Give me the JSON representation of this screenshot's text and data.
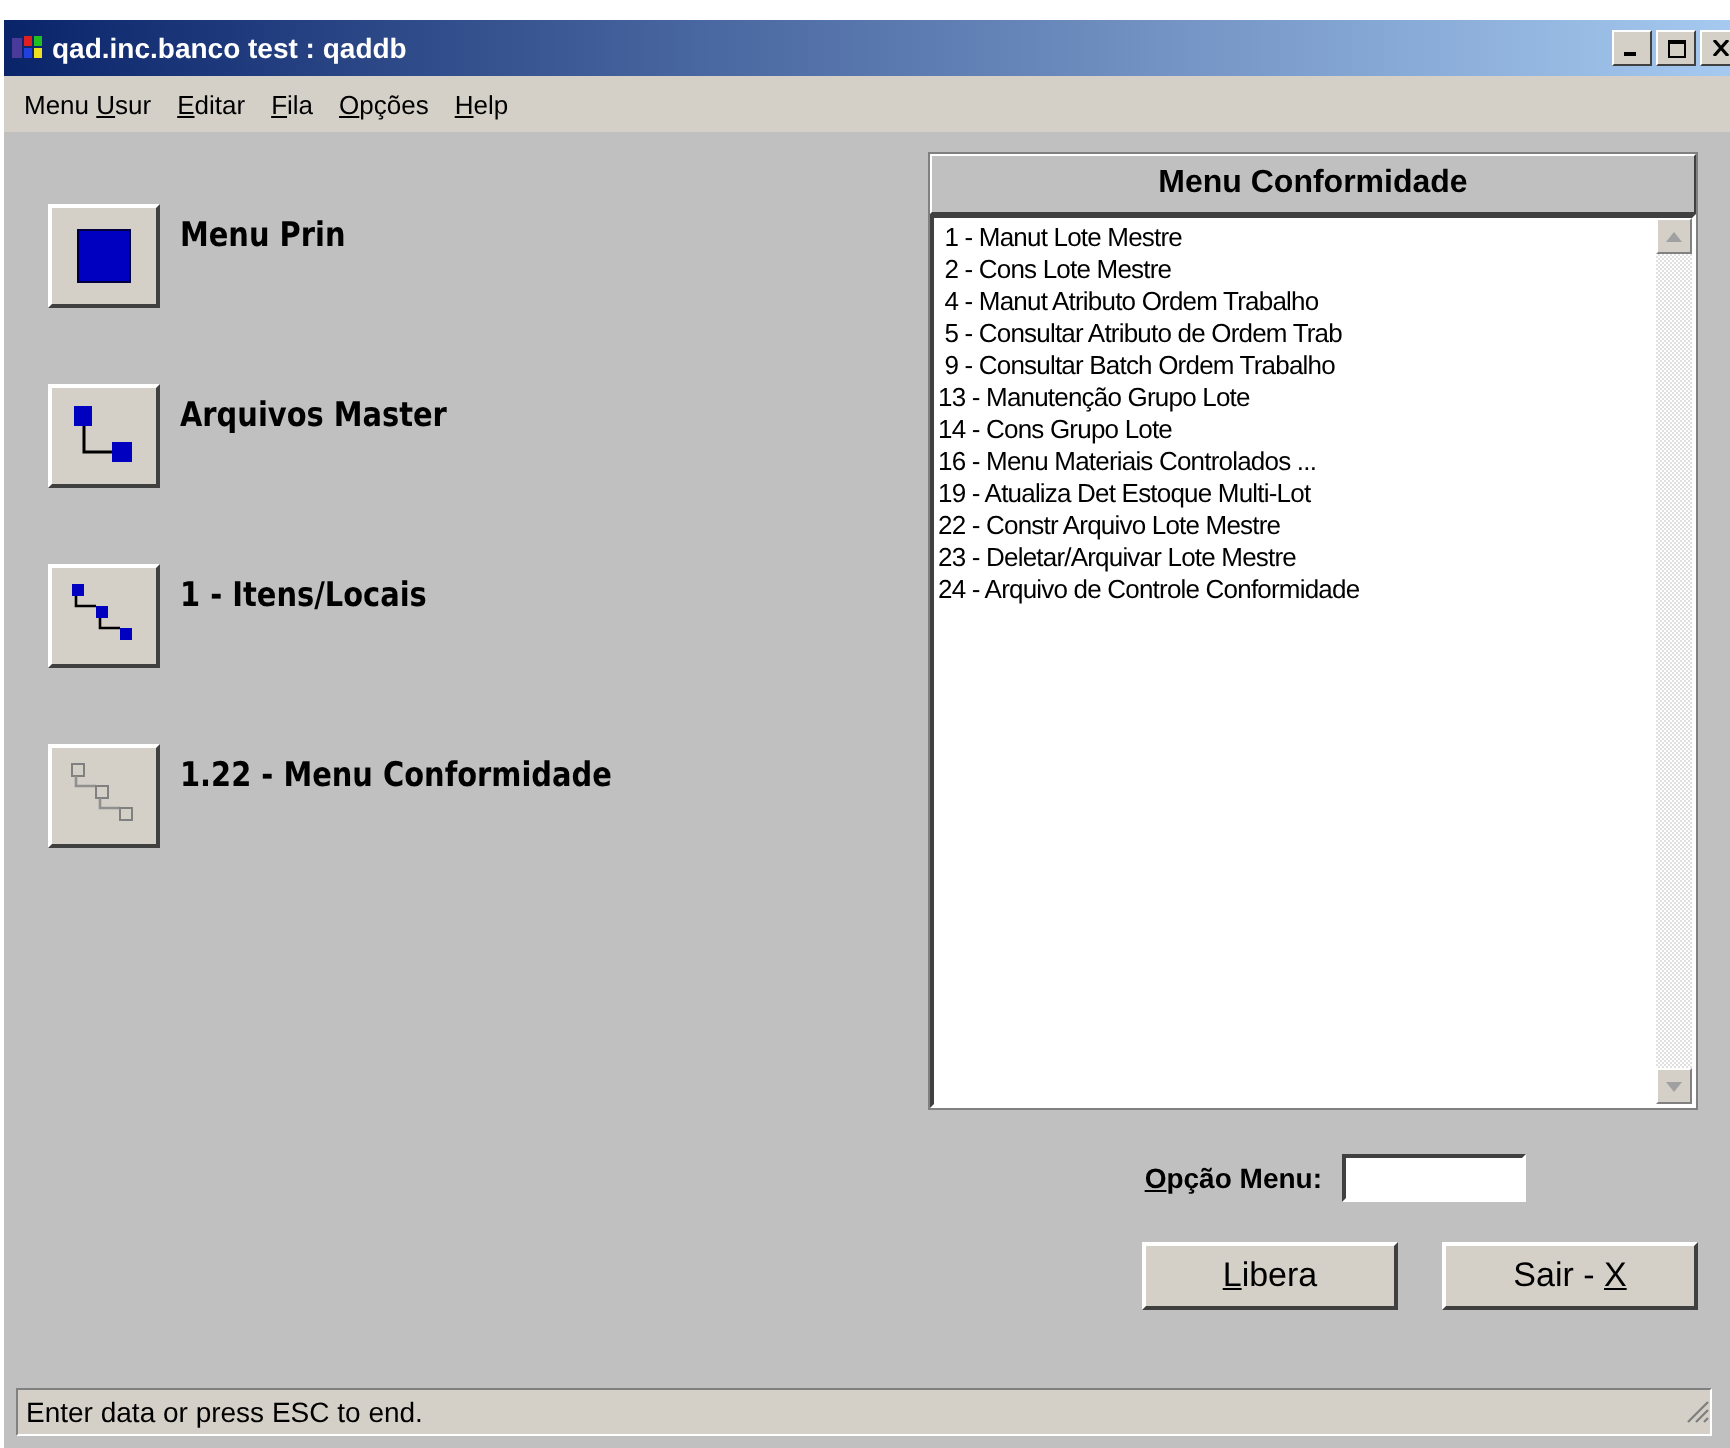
{
  "window": {
    "title": "qad.inc.banco test : qaddb"
  },
  "menu_bar": [
    {
      "before": "Menu ",
      "key": "U",
      "after": "sur"
    },
    {
      "key": "E",
      "after": "ditar"
    },
    {
      "key": "F",
      "after": "ila"
    },
    {
      "key": "O",
      "after": "pções"
    },
    {
      "key": "H",
      "after": "elp"
    }
  ],
  "path": [
    {
      "label": "Menu Prin",
      "disabled": false
    },
    {
      "label": "Arquivos Master",
      "disabled": false
    },
    {
      "label": "1 - Itens/Locais",
      "disabled": false
    },
    {
      "label": "1.22 - Menu Conformidade",
      "disabled": true
    }
  ],
  "menu_panel": {
    "title": "Menu Conformidade",
    "items": [
      {
        "label": " 1 - Manut Lote Mestre"
      },
      {
        "label": " 2 - Cons Lote Mestre"
      },
      {
        "label": " 4 - Manut Atributo Ordem Trabalho"
      },
      {
        "label": " 5 - Consultar Atributo de Ordem Trab"
      },
      {
        "label": " 9 - Consultar Batch Ordem Trabalho"
      },
      {
        "label": "13 - Manutenção Grupo Lote"
      },
      {
        "label": "14 - Cons Grupo Lote"
      },
      {
        "label": "16 - Menu Materiais Controlados ..."
      },
      {
        "label": "19 - Atualiza Det Estoque Multi-Lot"
      },
      {
        "label": "22 - Constr Arquivo Lote Mestre"
      },
      {
        "label": "23 - Deletar/Arquivar Lote Mestre"
      },
      {
        "label": "24 - Arquivo de Controle Conformidade"
      }
    ]
  },
  "option_field": {
    "label": {
      "key": "O",
      "after": "pção Menu:"
    }
  },
  "buttons": [
    {
      "key": "L",
      "after": "ibera"
    },
    {
      "before": "Sair - ",
      "key": "X"
    }
  ],
  "status_bar": "Enter data or press ESC to end."
}
